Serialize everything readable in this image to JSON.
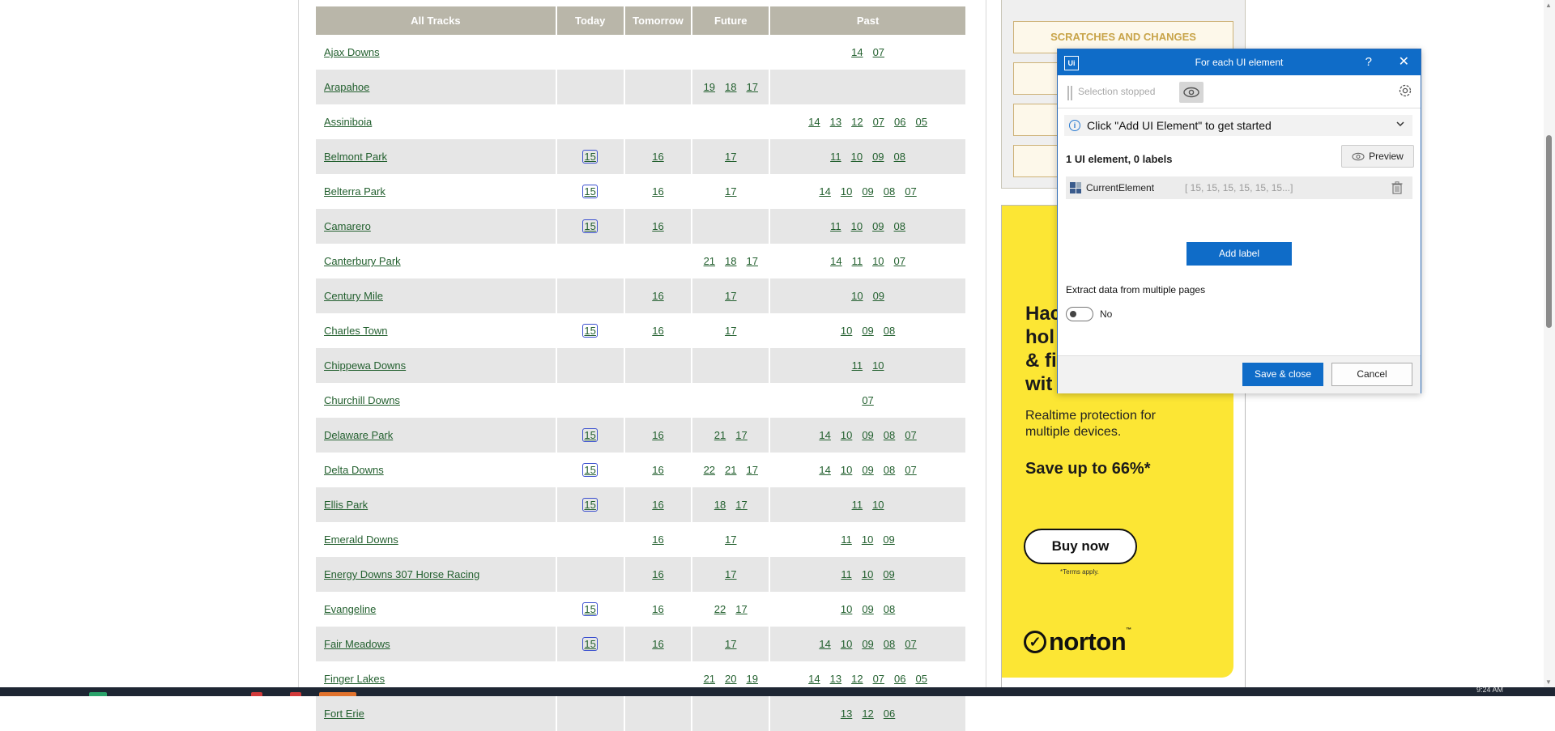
{
  "tracks_table": {
    "headers": {
      "all_tracks": "All Tracks",
      "today": "Today",
      "tomorrow": "Tomorrow",
      "future": "Future",
      "past": "Past"
    },
    "rows": [
      {
        "name": "Ajax Downs",
        "today": "",
        "tomorrow": "",
        "future": [],
        "past": [
          "14",
          "07"
        ]
      },
      {
        "name": "Arapahoe",
        "today": "",
        "tomorrow": "",
        "future": [
          "19",
          "18",
          "17"
        ],
        "past": []
      },
      {
        "name": "Assiniboia",
        "today": "",
        "tomorrow": "",
        "future": [],
        "past": [
          "14",
          "13",
          "12",
          "07",
          "06",
          "05"
        ]
      },
      {
        "name": "Belmont Park",
        "today": "15",
        "tomorrow": "16",
        "future": [
          "17"
        ],
        "past": [
          "11",
          "10",
          "09",
          "08"
        ]
      },
      {
        "name": "Belterra Park",
        "today": "15",
        "tomorrow": "16",
        "future": [
          "17"
        ],
        "past": [
          "14",
          "10",
          "09",
          "08",
          "07"
        ]
      },
      {
        "name": "Camarero",
        "today": "15",
        "tomorrow": "16",
        "future": [],
        "past": [
          "11",
          "10",
          "09",
          "08"
        ]
      },
      {
        "name": "Canterbury Park",
        "today": "",
        "tomorrow": "",
        "future": [
          "21",
          "18",
          "17"
        ],
        "past": [
          "14",
          "11",
          "10",
          "07"
        ]
      },
      {
        "name": "Century Mile",
        "today": "",
        "tomorrow": "16",
        "future": [
          "17"
        ],
        "past": [
          "10",
          "09"
        ]
      },
      {
        "name": "Charles Town",
        "today": "15",
        "tomorrow": "16",
        "future": [
          "17"
        ],
        "past": [
          "10",
          "09",
          "08"
        ]
      },
      {
        "name": "Chippewa Downs",
        "today": "",
        "tomorrow": "",
        "future": [],
        "past": [
          "11",
          "10"
        ]
      },
      {
        "name": "Churchill Downs",
        "today": "",
        "tomorrow": "",
        "future": [],
        "past": [
          "07"
        ]
      },
      {
        "name": "Delaware Park",
        "today": "15",
        "tomorrow": "16",
        "future": [
          "21",
          "17"
        ],
        "past": [
          "14",
          "10",
          "09",
          "08",
          "07"
        ]
      },
      {
        "name": "Delta Downs",
        "today": "15",
        "tomorrow": "16",
        "future": [
          "22",
          "21",
          "17"
        ],
        "past": [
          "14",
          "10",
          "09",
          "08",
          "07"
        ]
      },
      {
        "name": "Ellis Park",
        "today": "15",
        "tomorrow": "16",
        "future": [
          "18",
          "17"
        ],
        "past": [
          "11",
          "10"
        ]
      },
      {
        "name": "Emerald Downs",
        "today": "",
        "tomorrow": "16",
        "future": [
          "17"
        ],
        "past": [
          "11",
          "10",
          "09"
        ]
      },
      {
        "name": "Energy Downs 307 Horse Racing",
        "today": "",
        "tomorrow": "16",
        "future": [
          "17"
        ],
        "past": [
          "11",
          "10",
          "09"
        ]
      },
      {
        "name": "Evangeline",
        "today": "15",
        "tomorrow": "16",
        "future": [
          "22",
          "17"
        ],
        "past": [
          "10",
          "09",
          "08"
        ]
      },
      {
        "name": "Fair Meadows",
        "today": "15",
        "tomorrow": "16",
        "future": [
          "17"
        ],
        "past": [
          "14",
          "10",
          "09",
          "08",
          "07"
        ]
      },
      {
        "name": "Finger Lakes",
        "today": "",
        "tomorrow": "",
        "future": [
          "21",
          "20",
          "19"
        ],
        "past": [
          "14",
          "13",
          "12",
          "07",
          "06",
          "05"
        ]
      },
      {
        "name": "Fort Erie",
        "today": "",
        "tomorrow": "",
        "future": [],
        "past": [
          "13",
          "12",
          "06"
        ]
      }
    ]
  },
  "sidebar": {
    "scratches_button": "SCRATCHES AND CHANGES"
  },
  "ad": {
    "headline_lines": [
      "Hac",
      "hol",
      "& fi",
      "wit"
    ],
    "subtext": "Realtime protection for multiple devices.",
    "save_text": "Save up to 66%*",
    "buy_button": "Buy now",
    "terms": "*Terms apply.",
    "brand": "norton",
    "brand_tm": "™",
    "bg_color": "#fce634"
  },
  "dialog": {
    "title": "For each UI element",
    "help": "?",
    "close": "✕",
    "logo": "Ui",
    "selection_status": "Selection stopped",
    "info_text": "Click \"Add UI Element\" to get started",
    "count_text": "1 UI element, 0 labels",
    "preview_button": "Preview",
    "element": {
      "name": "CurrentElement",
      "values": "[ 15, 15, 15, 15, 15, 15...]"
    },
    "add_label_button": "Add label",
    "extract_label": "Extract data from multiple pages",
    "toggle_value": "No",
    "save_button": "Save & close",
    "cancel_button": "Cancel",
    "accent_color": "#0f6cc8"
  },
  "taskbar": {
    "time": "9:24 AM"
  }
}
